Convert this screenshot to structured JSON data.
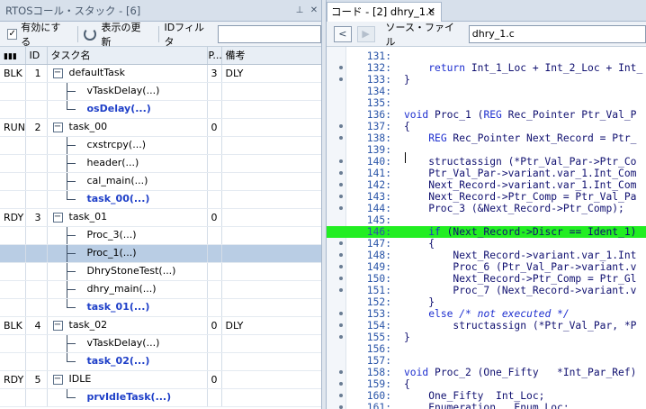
{
  "left": {
    "title": "RTOSコール・スタック - [6]",
    "pin_icon": "pin-icon",
    "close_icon": "close-icon",
    "toolbar": {
      "enable_checked": true,
      "enable_label": "有効にする",
      "refresh_label": "表示の更新",
      "id_filter_label": "IDフィルタ",
      "id_filter_value": ""
    },
    "columns": [
      "",
      "ID",
      "タスク名",
      "P...",
      "備考"
    ],
    "tasks": [
      {
        "state": "BLK",
        "id": "1",
        "name": "defaultTask",
        "priority": "3",
        "note": "DLY",
        "calls": [
          "vTaskDelay(...)",
          "osDelay(...)"
        ]
      },
      {
        "state": "RUN",
        "id": "2",
        "name": "task_00",
        "priority": "0",
        "note": "",
        "calls": [
          "cxstrcpy(...)",
          "header(...)",
          "cal_main(...)",
          "task_00(...)"
        ]
      },
      {
        "state": "RDY",
        "id": "3",
        "name": "task_01",
        "priority": "0",
        "note": "",
        "calls": [
          "Proc_3(...)",
          "Proc_1(...)",
          "DhryStoneTest(...)",
          "dhry_main(...)",
          "task_01(...)"
        ]
      },
      {
        "state": "BLK",
        "id": "4",
        "name": "task_02",
        "priority": "0",
        "note": "DLY",
        "calls": [
          "vTaskDelay(...)",
          "task_02(...)"
        ]
      },
      {
        "state": "RDY",
        "id": "5",
        "name": "IDLE",
        "priority": "0",
        "note": "",
        "calls": [
          "prvIdleTask(...)"
        ]
      }
    ],
    "selected_call": "Proc_1(...)"
  },
  "right": {
    "tab_label": "コード - [2] dhry_1.c",
    "source_file_label": "ソース・ファイル",
    "source_file_value": "dhry_1.c",
    "highlight_color": "#22ee22",
    "code": [
      {
        "n": "131",
        "t": ""
      },
      {
        "n": "132",
        "t": "    return Int_1_Loc + Int_2_Loc + Int_"
      },
      {
        "n": "133",
        "t": "}"
      },
      {
        "n": "134",
        "t": ""
      },
      {
        "n": "135",
        "t": ""
      },
      {
        "n": "136",
        "t": "void Proc_1 (REG Rec_Pointer Ptr_Val_P"
      },
      {
        "n": "137",
        "t": "{"
      },
      {
        "n": "138",
        "t": "    REG Rec_Pointer Next_Record = Ptr_"
      },
      {
        "n": "139",
        "t": ""
      },
      {
        "n": "140",
        "t": "    structassign (*Ptr_Val_Par->Ptr_Co"
      },
      {
        "n": "141",
        "t": "    Ptr_Val_Par->variant.var_1.Int_Com"
      },
      {
        "n": "142",
        "t": "    Next_Record->variant.var_1.Int_Com"
      },
      {
        "n": "143",
        "t": "    Next_Record->Ptr_Comp = Ptr_Val_Pa"
      },
      {
        "n": "144",
        "t": "    Proc_3 (&Next_Record->Ptr_Comp);"
      },
      {
        "n": "145",
        "t": ""
      },
      {
        "n": "146",
        "t": "    if (Next_Record->Discr == Ident_1)"
      },
      {
        "n": "147",
        "t": "    {"
      },
      {
        "n": "148",
        "t": "        Next_Record->variant.var_1.Int"
      },
      {
        "n": "149",
        "t": "        Proc_6 (Ptr_Val_Par->variant.v"
      },
      {
        "n": "150",
        "t": "        Next_Record->Ptr_Comp = Ptr_Gl"
      },
      {
        "n": "151",
        "t": "        Proc_7 (Next_Record->variant.v"
      },
      {
        "n": "152",
        "t": "    }"
      },
      {
        "n": "153",
        "t": "    else /* not executed */"
      },
      {
        "n": "154",
        "t": "        structassign (*Ptr_Val_Par, *P"
      },
      {
        "n": "155",
        "t": "}"
      },
      {
        "n": "156",
        "t": ""
      },
      {
        "n": "157",
        "t": ""
      },
      {
        "n": "158",
        "t": "void Proc_2 (One_Fifty   *Int_Par_Ref)"
      },
      {
        "n": "159",
        "t": "{"
      },
      {
        "n": "160",
        "t": "    One_Fifty  Int_Loc;"
      },
      {
        "n": "161",
        "t": "    Enumeration   Enum_Loc;"
      }
    ],
    "highlight_line": "146",
    "dotted_lines": [
      "132",
      "133",
      "137",
      "138",
      "140",
      "141",
      "142",
      "143",
      "144",
      "147",
      "148",
      "149",
      "150",
      "151",
      "153",
      "154",
      "155",
      "158",
      "159",
      "160",
      "161"
    ]
  }
}
